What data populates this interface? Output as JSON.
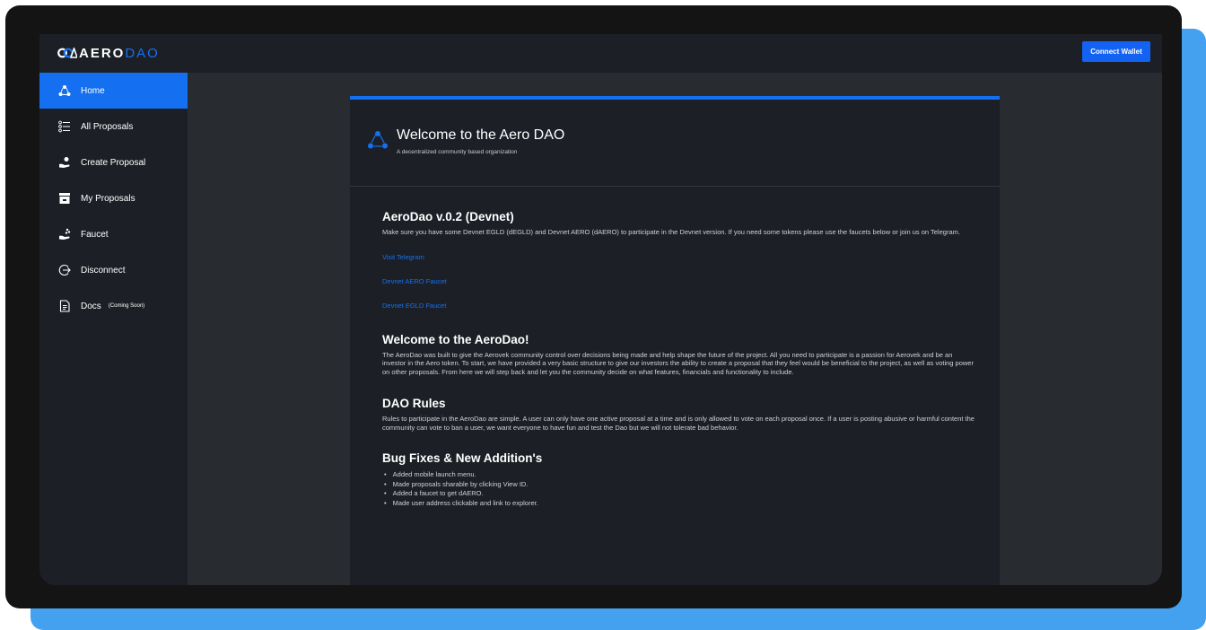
{
  "brand": {
    "aero": "AERO",
    "dao": "DAO"
  },
  "header": {
    "connect_wallet": "Connect Wallet"
  },
  "sidebar": {
    "items": [
      {
        "label": "Home",
        "icon": "network-icon",
        "active": true
      },
      {
        "label": "All Proposals",
        "icon": "list-icon"
      },
      {
        "label": "Create Proposal",
        "icon": "hand-person-icon"
      },
      {
        "label": "My Proposals",
        "icon": "inbox-icon"
      },
      {
        "label": "Faucet",
        "icon": "faucet-icon"
      },
      {
        "label": "Disconnect",
        "icon": "logout-icon"
      },
      {
        "label": "Docs",
        "icon": "document-icon",
        "note": "(Coming Soon)"
      }
    ]
  },
  "welcome": {
    "title": "Welcome to the Aero DAO",
    "subtitle": "A decentralized community based organization"
  },
  "sections": {
    "devnet": {
      "title": "AeroDao v.0.2 (Devnet)",
      "text": "Make sure you have some Devnet EGLD (dEGLD) and Devnet AERO (dAERO) to participate in the Devnet version. If you need some tokens please use the faucets below or join us on Telegram.",
      "links": [
        "Visit Telegram",
        "Devnet AERO Faucet",
        "Devnet EGLD Faucet"
      ]
    },
    "about": {
      "title": "Welcome to the AeroDao!",
      "text": "The AeroDao was built to give the Aerovek community control over decisions being made and help shape the future of the project. All you need to participate is a passion for Aerovek and be an investor in the Aero token. To start, we have provided a very basic structure to give our investors the ability to create a proposal that they feel would be beneficial to the project, as well as voting power on other proposals. From here we will step back and let you the community decide on what features, financials and functionality to include."
    },
    "rules": {
      "title": "DAO Rules",
      "text": "Rules to participate in the AeroDao are simple. A user can only have one active proposal at a time and is only allowed to vote on each proposal once. If a user is posting abusive or harmful content the community can vote to ban a user, we want everyone to have fun and test the Dao but we will not tolerate bad behavior."
    },
    "fixes": {
      "title": "Bug Fixes & New Addition's",
      "items": [
        "Added mobile launch menu.",
        "Made proposals sharable by clicking View ID.",
        "Added a faucet to get dAERO.",
        "Made user address clickable and link to explorer."
      ]
    }
  },
  "colors": {
    "accent": "#1470f0",
    "sidebar_bg": "#1c2026",
    "main_bg": "#282c31",
    "backdrop": "#43a1f0"
  }
}
